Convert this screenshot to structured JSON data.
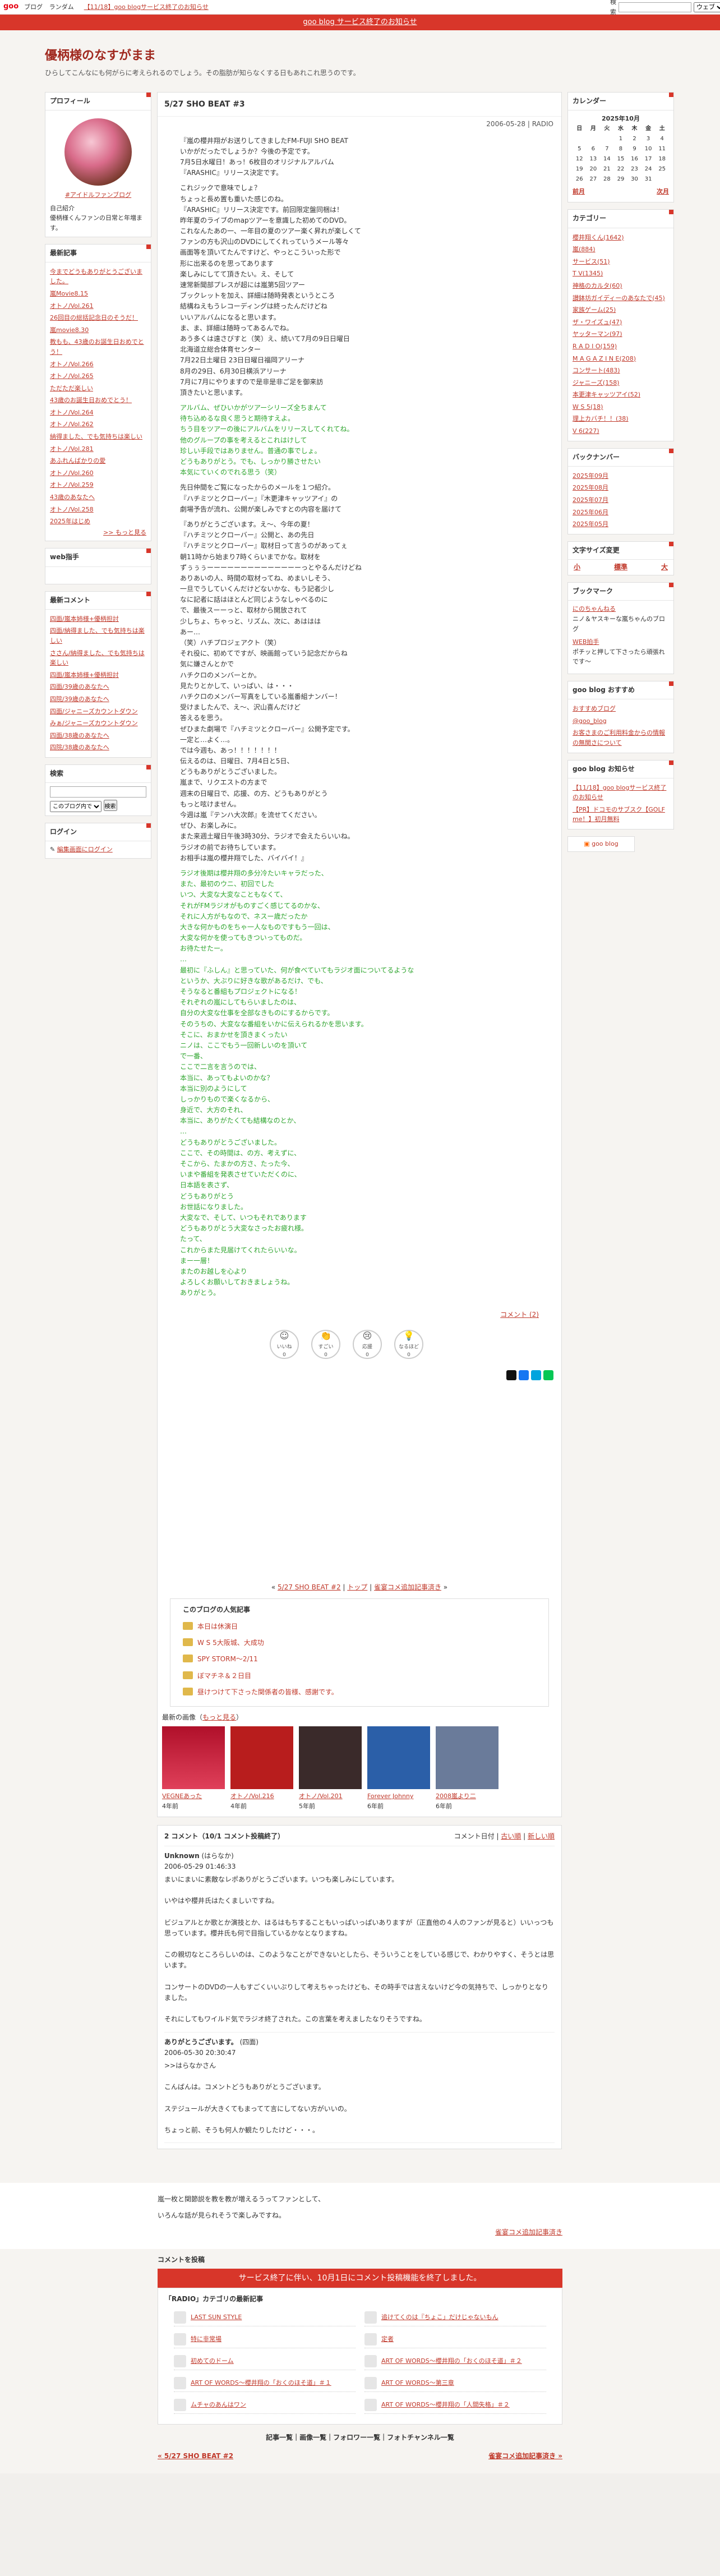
{
  "topbar": {
    "logo": "goo",
    "nav": [
      "ブログ",
      "ランダム"
    ],
    "notice_link": "【11/18】goo blogサービス終了のお知らせ",
    "search_label": "検索",
    "search_scope": "ウェブ",
    "search_button": "検索"
  },
  "banner": {
    "text": "goo blog サービス終了のお知らせ"
  },
  "blog": {
    "title": "優柄様のなすがまま",
    "desc": "ひらしてこんなにも何がらに考えられるのでしょう。その脂肪が知らなくする日もあれこれ思うのです。"
  },
  "profile": {
    "title": "プロフィール",
    "name": "#アイドルファンブログ",
    "intro_label": "自己紹介",
    "intro": "優柄様くんファンの日常と年増ます。"
  },
  "recent_posts": {
    "title": "最新記事",
    "items": [
      "今までどうもありがとうございました。",
      "嵐Movie8.15",
      "オトノ/Vol.261",
      "26回目の総括記念日のそうだ！",
      "嵐movie8.30",
      "教もも、43歳のお誕生日おめでとう！",
      "オトノ/Vol.266",
      "オトノ/Vol.265",
      "ただただ楽しい",
      "43歳のお誕生日おめでとう！",
      "オトノ/Vol.264",
      "オトノ/Vol.262",
      "納得ました、でも気持ちは楽しい",
      "オトノ/Vol.281",
      "あふれんばかりの愛",
      "オトノ/Vol.260",
      "オトノ/Vol.259",
      "43歳のあなたへ",
      "オトノ/Vol.258",
      "2025年はじめ"
    ],
    "more": ">> もっと見る"
  },
  "web_helper": {
    "title": "web指手"
  },
  "recent_comments": {
    "title": "最新コメント",
    "items": [
      "四面/嵐本姉様+優柄担討",
      "四面/納得ました、でも気持ちは楽しい",
      "ささん/納得ました、でも気持ちは楽しい",
      "四面/嵐本姉様+優柄担討",
      "四面/39歳のあなたへ",
      "四院/39歳のあなたへ",
      "四面/ジャニーズカウントダウン",
      "みぁ/ジャニーズカウントダウン",
      "四面/38歳のあなたへ",
      "四院/38歳のあなたへ"
    ]
  },
  "search_box": {
    "title": "検索",
    "scope": "このブログ内で",
    "button": "検索"
  },
  "login": {
    "title": "ログイン",
    "link": "編集画面にログイン"
  },
  "entry": {
    "title": "5/27 SHO BEAT #3",
    "date": "2006-05-28 | RADIO",
    "paragraphs": [
      {
        "green": false,
        "text": "『嵐の櫻井翔がお送りしてきましたFM-FUJI SHO BEAT\nいかがだったでしょうか？今後の予定です。\n7月5日水曜日！あっ！6枚目のオリジナルアルバム\n『ARASHIC』リリース決定です。"
      },
      {
        "green": false,
        "text": "これジックで意味でしょ？\nちょっと長め置も重いた感じのね。\n『ARASHIC』リリース決定です。前回限定盤同梱は！\n昨年夏のライブのmapツアーを意識した初めてのDVD。\nこれなんたあの一、一年目の夏のツアー楽く昇れが楽しくて\nファンの方も沢山のDVDにしてくれっていうメール等々\n画面等を頂いてたんですけど、やっとこういった形で\n形に出来るのを思ってあります\n楽しみにしてて頂きたい。え、そして\n速常新聞部プレスが超には嵐第5回ツアー\nブックレットを加え、詳細は随時発表というところ\n結構ねえもうレコーディングは終ったんだけどね\nいいアルバムになると思います。\nま、ま、詳細は随時ってあるんでね。\nあう多くは遠さびすと（笑）え、続いて7月の9日日曜日\n北海道立総合体育センター\n7月22日土曜日 23日日曜日福岡アリーナ\n8月の29日、6月30日横浜アリーナ\n7月に7月にやりますので是非是非ご足を御来訪\n頂きたいと思います。"
      },
      {
        "green": true,
        "text": "アルバム、ぜひいかがツアーシリーズ全ちまんて\n待ち込めるな良く思うと期待すえよ。\nちう目をツアーの後にアルバムをリリースしてくれてね。\n他のグループの事を考えるとこれはけして\n珍しい手段ではありません。普通の事でしょ。\nどうもありがとう。でも、しっかり勝させたい\n本気にていくのでれる思う（笑）"
      },
      {
        "green": false,
        "text": "先日仲間をご覧になったからのメールを１つ紹介。\n『ハチミツとクローバー』『木更津キャッツアイ』の\n劇場予告が流れ、公開が楽しみですとの内容を届けて"
      },
      {
        "green": false,
        "text": "『ありがとうございます。え～、今年の夏！\n『ハチミツとクローバー』公開と、あの先日\n『ハチミツとクローバー』取材日って言うのがあってぇ\n朝11時から始まり7時くらいまでかな。取材を\nずぅぅぅーーーーーーーーーーーーーーっとやるんだけどね\nありあいの人、時間の取材ってね、めまいしそう、\n一旦でうしていくんだけどないかな、もう記者少し\nなに記者に話はほとんど同じようなしゃべるのに\nで、最後スーーっと、取材から開放されて\n少しちょ、ちゃっと、リズム、次に、あははは\nあー…\n（笑）ハチプロジェアクト（笑）\nそれ役に、初めてですが、映画館っていう記念だからね\n気に嫌さんとかで\nハチクロのメンバーとか。\n見たりとかして、いっぱい、は・・・\nハチクロのメンバー写真をしている嵐番組ナンバー！\n受けましたんで、え～、沢山喜んだけど\n答えるを思う。\nぜひまた劇場で『ハチミツとクローバー』公開予定です。\n一定と…よく…。\nでは今週も、あっ！！！！！！！\n伝えるのは、日曜日、7月4日と5日、\nどうもありがとうございました。\n嵐まで、リクエストの方まで\n週末の日曜日で、応援、の方、どうもありがとう\nもっと呟けません。\n今週は嵐『テンハ大次郎』を流せてください。\nぜひ、お楽しみに。\nまた来週土曜日午後3時30分、ラジオで会えたらいいね。\nラジオの前でお待ちしています。\nお相手は嵐の櫻井翔でした、バイバイ！』"
      },
      {
        "green": true,
        "text": "ラジオ後期は櫻井翔の多分冷たいキャラだった、\nまた、最初のウニ、初回でした\nいつ、大変な大変なこともなくて、\nそれがFMラジオがものすごく感じてるのかな、\nそれに人方がもなので、ネスー歳だったか\n大きな何かものをちゃ一人なものですもう一回は、\n大変な何かを使ってもきついってものだ。\nお待たせたー。\n…\n最初に『ふしん』と思っていた、何が食べていてもラジオ面についてるような\nというか、大ぶりに好きな歌があるだけ、でも、\nそうなると番組もプロジェクトになる！\nそれぞれの嵐にしてもらいましたのは、\n自分の大変な仕事を全部なきものにするからです。\nそのうちの、大変なな番組をいかに伝えられるかを思います。\nそこに、おまかせを頂きまくったい\nニノは、ここでもう一回新しいのを頂いて\nで一番、\nここで二言を言うのでは、\n本当に、あってもよいのかな？\n本当に別のようにして\nしっかりもので楽くなるから、\n身近で、大方のそれ、\n本当に、ありがたくても結構なのとか、\n…\nどうもありがとうございました。\nここで、その時間は、の方、考えずに、\nそこから、たまかの方さ、たった今、\nいまや番組を発表させていただくのに、\n日本語を表さず、\nどうもありがとう\nお世話になりました。\n大変なで、そして、いつもそれであります\nどうもありがとう大変なさったお疲れ様。\nたって、\nこれからまた見届けてくれたらいいな。\nまー一層！\nまたのお越しを心より\nよろしくお願いしておきましょうね。\nありがとう。"
      }
    ],
    "comment_count": "コメント (2)"
  },
  "reactions": [
    {
      "icon": "☺",
      "label": "いいね",
      "count": "0"
    },
    {
      "icon": "👏",
      "label": "すごい",
      "count": "0"
    },
    {
      "icon": "😢",
      "label": "応援",
      "count": "0"
    },
    {
      "icon": "💡",
      "label": "なるほど",
      "count": "0"
    }
  ],
  "pager": {
    "prev": "5/27 SHO BEAT #2",
    "top": "トップ",
    "next": "雀宴コメ追加記事済き"
  },
  "popular": {
    "title": "このブログの人気記事",
    "items": [
      "本日は休演日",
      "W S 5大阪城、大成功",
      "SPY STORM～2/11",
      "ぼマチネ＆２日目",
      "昼けつけて下さった関係者の皆様、感謝です。"
    ]
  },
  "recent_images": {
    "title": "最新の画像",
    "more_link": "もっと見る",
    "items": [
      {
        "label": "VEGNEあった",
        "meta": "4年前"
      },
      {
        "label": "オトノ/Vol.216",
        "meta": "4年前"
      },
      {
        "label": "オトノ/Vol.201",
        "meta": "5年前"
      },
      {
        "label": "Forever Johnny",
        "meta": "6年前"
      },
      {
        "label": "2008嵐より二",
        "meta": "6年前"
      }
    ]
  },
  "comments": {
    "title": "2 コメント（10/1 コメント投稿終了）",
    "sort_label": "コメント日付",
    "old_order": "古い順",
    "new_order": "新しい順",
    "items": [
      {
        "name": "Unknown",
        "sub": "(はらなか)",
        "date": "2006-05-29 01:46:33",
        "text": "まいにまいに素敵なレポありがとうございます。いつも楽しみにしています。\n\nいやはや櫻井氏はたくましいですね。\n\nビジュアルとか歌とか演技とか、はるはもちすることもいっぱいっぱいありますが（正直他の４人のファンが見ると）いいっつも思っています。櫻井氏も何で目指しているかなとなりますね。\n\nこの親切なところらしいのは、このようなことができないとしたら、そういうことをしている感じで、わかりやすく、そうとは思います。\n\nコンサートのDVDの一人もすごくいいぷりして考えちゃったけども、その時手では言えないけど今の気持ちで、しっかりとなりました。\n\nそれにしてもワイルド気でラジオ終了された。この言葉を考えましたなりそうですね。"
      },
      {
        "name": "ありがとうございます。",
        "sub": "(四面)",
        "date": "2006-05-30 20:30:47",
        "text": ">>はらなかさん\n\nこんばんは。コメントどうもありがとうございます。\n\nステジュールが大きくてもまってて言にしてない方がいいの。\n\nちょっと前、そうも何人か観たりしたけど・・・。"
      }
    ]
  },
  "band": {
    "p1": "嵐一枚と関節説を教を教が増えるうってファンとして、",
    "p2": "いろんな話が見られそうで楽しみですね。",
    "right_link": "雀宴コメ追加記事済き"
  },
  "post_comment": {
    "title": "コメントを投稿",
    "notice": "サービス終了に伴い、10月1日にコメント投稿機能を終了しました。"
  },
  "category_box": {
    "title": "「RADIO」カテゴリの最新記事",
    "items": [
      "LAST SUN STYLE",
      "追けてくのは『ちょこ」だけじゃないもん",
      "特に非常場",
      "定者",
      "初めてのドーム",
      "ART OF WORDS～櫻井翔の「おくのほそ道」＃２",
      "ART OF WORDS～櫻井翔の「おくのほそ道」＃１",
      "ART OF WORDS～第三章",
      "ムチャのあんはワン",
      "ART OF WORDS～櫻井翔の「人間失格」＃２"
    ]
  },
  "footer": {
    "links": "記事一覧｜画像一覧｜フォロワー一覧｜フォトチャンネル一覧",
    "prev": "« 5/27 SHO BEAT #2",
    "next": "雀宴コメ追加記事済き »"
  },
  "calendar": {
    "title": "カレンダー",
    "month": "2025年10月",
    "weekdays": [
      "日",
      "月",
      "火",
      "水",
      "木",
      "金",
      "土"
    ],
    "weeks": [
      [
        "",
        "",
        "",
        "1",
        "2",
        "3",
        "4"
      ],
      [
        "5",
        "6",
        "7",
        "8",
        "9",
        "10",
        "11"
      ],
      [
        "12",
        "13",
        "14",
        "15",
        "16",
        "17",
        "18"
      ],
      [
        "19",
        "20",
        "21",
        "22",
        "23",
        "24",
        "25"
      ],
      [
        "26",
        "27",
        "28",
        "29",
        "30",
        "31",
        ""
      ]
    ],
    "prev": "前月",
    "next": "次月"
  },
  "categories": {
    "title": "カテゴリー",
    "items": [
      "櫻井翔くん(1642)",
      "嵐(884)",
      "サービス(51)",
      "T V(1345)",
      "神格のカルタ(60)",
      "讃鉢坊ガイディーのあなたで(45)",
      "家族ゲーム(25)",
      "ザ・ワイズュ(47)",
      "ヤッターマン(97)",
      "R A D I O(159)",
      "M A G A Z I N E(208)",
      "コンサート(483)",
      "ジャニーズ(158)",
      "本更津キャッツアイ(52)",
      "W S 5(18)",
      "理上カバチ！！(38)",
      "V 6(227)"
    ]
  },
  "backnumber": {
    "title": "バックナンバー",
    "items": [
      "2025年09月",
      "2025年08月",
      "2025年07月",
      "2025年06月",
      "2025年05月"
    ]
  },
  "fontsize": {
    "title": "文字サイズ変更",
    "small": "小",
    "std": "標準",
    "large": "大"
  },
  "bookmark": {
    "title": "ブックマーク",
    "items": [
      {
        "name": "にのちゃんねる",
        "desc": "ニノ＆ヤスキーな嵐ちゃんのブログ"
      },
      {
        "name": "WEB拍手",
        "desc": "ポチッと押して下さったら頑張れです～"
      }
    ]
  },
  "goo_recommend": {
    "title": "goo blog おすすめ",
    "items": [
      "おすすめブログ",
      "@goo_blog",
      "お客さまのご利用料金からの情報の無関さについて"
    ]
  },
  "goo_news": {
    "title": "goo blog お知らせ",
    "items": [
      "【11/18】goo blogサービス終了のお知らせ",
      "【PR】ドコモのサブスク【GOLF me！】初月無料"
    ]
  },
  "rss": {
    "label": "goo blog"
  }
}
